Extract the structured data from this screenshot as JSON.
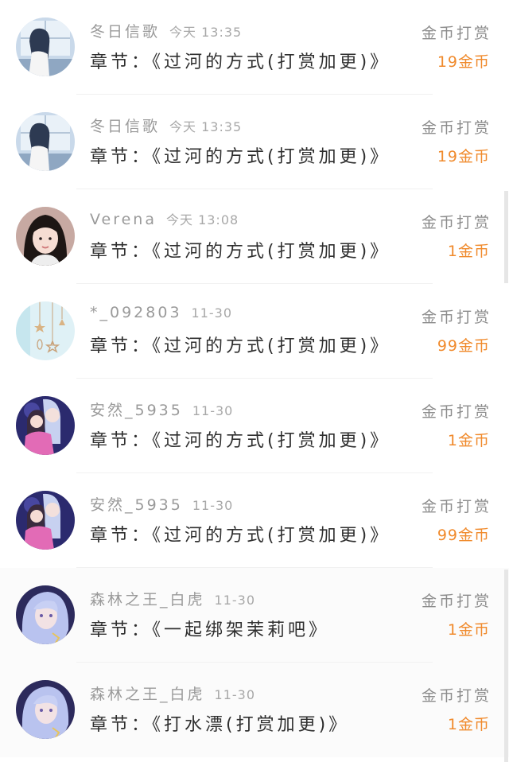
{
  "records": [
    {
      "user": "冬日信歌",
      "time": "今天  13:35",
      "chapter": "章节：《过河的方式(打赏加更)》",
      "reward_type": "金币打赏",
      "amount": "19金币",
      "avatar_icon": "anime-girl-window-avatar"
    },
    {
      "user": "冬日信歌",
      "time": "今天  13:35",
      "chapter": "章节：《过河的方式(打赏加更)》",
      "reward_type": "金币打赏",
      "amount": "19金币",
      "avatar_icon": "anime-girl-window-avatar"
    },
    {
      "user": "Verena",
      "time": "今天  13:08",
      "chapter": "章节：《过河的方式(打赏加更)》",
      "reward_type": "金币打赏",
      "amount": "1金币",
      "avatar_icon": "girl-photo-avatar"
    },
    {
      "user": "*_092803",
      "time": "11-30",
      "chapter": "章节：《过河的方式(打赏加更)》",
      "reward_type": "金币打赏",
      "amount": "99金币",
      "avatar_icon": "hanging-stars-avatar"
    },
    {
      "user": "安然_5935",
      "time": "11-30",
      "chapter": "章节：《过河的方式(打赏加更)》",
      "reward_type": "金币打赏",
      "amount": "1金币",
      "avatar_icon": "anime-couple-avatar"
    },
    {
      "user": "安然_5935",
      "time": "11-30",
      "chapter": "章节：《过河的方式(打赏加更)》",
      "reward_type": "金币打赏",
      "amount": "99金币",
      "avatar_icon": "anime-couple-avatar"
    },
    {
      "user": "森林之王_白虎",
      "time": "11-30",
      "chapter": "章节：《一起绑架茉莉吧》",
      "reward_type": "金币打赏",
      "amount": "1金币",
      "avatar_icon": "anime-silver-hair-avatar"
    },
    {
      "user": "森林之王_白虎",
      "time": "11-30",
      "chapter": "章节：《打水漂(打赏加更)》",
      "reward_type": "金币打赏",
      "amount": "1金币",
      "avatar_icon": "anime-silver-hair-avatar"
    }
  ],
  "colors": {
    "amount": "#f08a2c",
    "meta": "#9a9a9a",
    "chapter": "#2f2f2f"
  }
}
